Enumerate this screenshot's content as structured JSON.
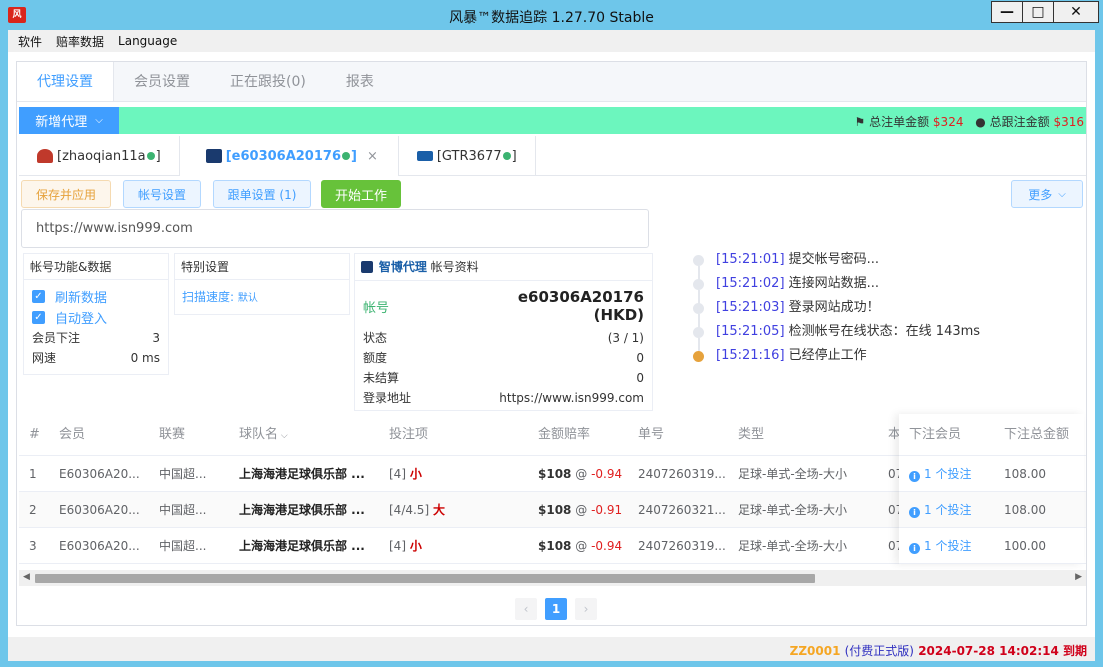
{
  "window": {
    "title": "风暴™数据追踪 1.27.70 Stable",
    "minimize": "—",
    "maximize": "□",
    "close": "✕"
  },
  "menu": [
    "软件",
    "赔率数据",
    "Language"
  ],
  "top_tabs": [
    "代理设置",
    "会员设置",
    "正在跟投(0)",
    "报表"
  ],
  "add_proxy_label": "新增代理",
  "stats": {
    "bet_label": "总注单金额",
    "bet_value": "$324",
    "follow_label": "总跟注金额",
    "follow_value": "$316"
  },
  "account_tabs": [
    {
      "label": "[zhaoqian11a",
      "suffix": "]"
    },
    {
      "label": "[e60306A20176",
      "suffix": "]",
      "close": "×"
    },
    {
      "label": "[GTR3677",
      "suffix": "]"
    }
  ],
  "toolbar": {
    "save": "保存并应用",
    "account": "帐号设置",
    "follow": "跟单设置 (1)",
    "start": "开始工作",
    "more": "更多"
  },
  "url_value": "https://www.isn999.com",
  "func_card": {
    "title": "帐号功能&数据",
    "refresh": "刷新数据",
    "autologin": "自动登入",
    "member_bet_label": "会员下注",
    "member_bet_value": "3",
    "speed_label": "网速",
    "speed_value": "0 ms"
  },
  "special_card": {
    "title": "特别设置",
    "scan_label": "扫描速度:",
    "scan_value": "默认"
  },
  "profile_card": {
    "brand": "智博代理",
    "title": "帐号资料",
    "account_label": "帐号",
    "account_value": "e60306A20176",
    "currency": "(HKD)",
    "status_label": "状态",
    "status_value": "(3 / 1)",
    "limit_label": "额度",
    "limit_value": "0",
    "unsettled_label": "未结算",
    "unsettled_value": "0",
    "login_label": "登录地址",
    "login_value": "https://www.isn999.com"
  },
  "log": [
    {
      "time": "[15:21:01]",
      "msg": "提交帐号密码..."
    },
    {
      "time": "[15:21:02]",
      "msg": "连接网站数据..."
    },
    {
      "time": "[15:21:03]",
      "msg": "登录网站成功！"
    },
    {
      "time": "[15:21:05]",
      "msg": "检测帐号在线状态：在线 143ms"
    },
    {
      "time": "[15:21:16]",
      "msg": "已经停止工作"
    }
  ],
  "table": {
    "headers": [
      "#",
      "会员",
      "联赛",
      "球队名",
      "投注项",
      "金额赔率",
      "单号",
      "类型",
      "本",
      "下注会员",
      "下注总金额"
    ],
    "rows": [
      {
        "no": "1",
        "member": "E60306A20...",
        "league": "中国超...",
        "team": "上海海港足球俱乐部 ...",
        "bet_hcp": "[4]",
        "bet_pick": "小",
        "amount": "$108",
        "at": "@",
        "odds": "-0.94",
        "order": "2407260319...",
        "type": "足球-单式-全场-大小",
        "extra": "07",
        "bettors": "1 个投注",
        "total": "108.00"
      },
      {
        "no": "2",
        "member": "E60306A20...",
        "league": "中国超...",
        "team": "上海海港足球俱乐部 ...",
        "bet_hcp": "[4/4.5]",
        "bet_pick": "大",
        "amount": "$108",
        "at": "@",
        "odds": "-0.91",
        "order": "2407260321...",
        "type": "足球-单式-全场-大小",
        "extra": "07",
        "bettors": "1 个投注",
        "total": "108.00"
      },
      {
        "no": "3",
        "member": "E60306A20...",
        "league": "中国超...",
        "team": "上海海港足球俱乐部 ...",
        "bet_hcp": "[4]",
        "bet_pick": "小",
        "amount": "$108",
        "at": "@",
        "odds": "-0.94",
        "order": "2407260319...",
        "type": "足球-单式-全场-大小",
        "extra": "07",
        "bettors": "1 个投注",
        "total": "100.00"
      }
    ]
  },
  "pager": {
    "prev": "‹",
    "current": "1",
    "next": "›"
  },
  "status": {
    "code": "ZZ0001",
    "edition": "(付费正式版)",
    "expiry": "2024-07-28 14:02:14 到期"
  }
}
